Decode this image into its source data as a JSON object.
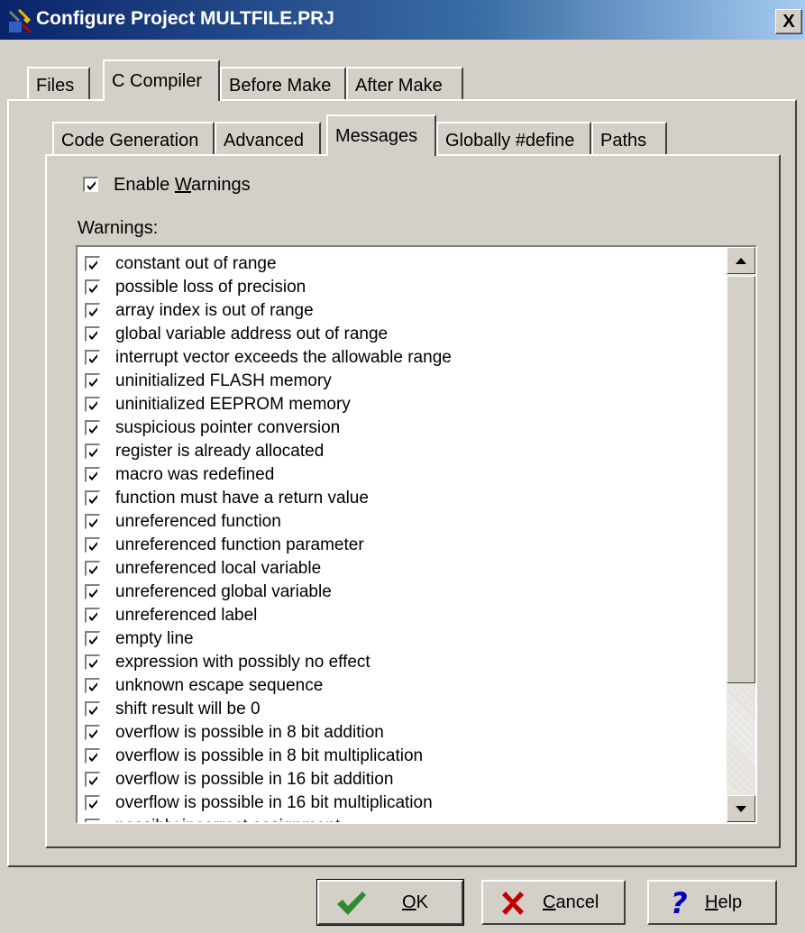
{
  "window": {
    "title": "Configure Project MULTFILE.PRJ",
    "close_label": "X"
  },
  "tabs_top": [
    {
      "label": "Files",
      "active": false
    },
    {
      "label": "C Compiler",
      "active": true
    },
    {
      "label": "Before Make",
      "active": false
    },
    {
      "label": "After Make",
      "active": false
    }
  ],
  "tabs_sub": [
    {
      "label": "Code Generation",
      "active": false
    },
    {
      "label": "Advanced",
      "active": false
    },
    {
      "label": "Messages",
      "active": true
    },
    {
      "label": "Globally #define",
      "active": false
    },
    {
      "label": "Paths",
      "active": false
    }
  ],
  "enable_warnings": {
    "checked": true,
    "label_pre": "Enable ",
    "label_accel": "W",
    "label_post": "arnings"
  },
  "warnings_label": "Warnings:",
  "warnings": [
    "constant out of range",
    "possible loss of precision",
    "array index is out of range",
    "global variable address out of range",
    "interrupt vector exceeds the allowable range",
    "uninitialized FLASH memory",
    "uninitialized EEPROM memory",
    "suspicious pointer conversion",
    "register is already allocated",
    "macro was redefined",
    "function must have a return value",
    "unreferenced function",
    "unreferenced function parameter",
    "unreferenced local variable",
    "unreferenced global variable",
    "unreferenced label",
    "empty line",
    "expression with possibly no effect",
    "unknown escape sequence",
    "shift result will be 0",
    "overflow is possible in 8 bit addition",
    "overflow is possible in 8 bit multiplication",
    "overflow is possible in 16 bit addition",
    "overflow is possible in 16 bit multiplication",
    "possibly incorrect assignment"
  ],
  "buttons": {
    "ok": {
      "accel": "O",
      "rest": "K",
      "icon": "checkmark-icon",
      "color": "#2e8b2e"
    },
    "cancel": {
      "accel": "C",
      "rest": "ancel",
      "icon": "x-icon",
      "color": "#c00000"
    },
    "help": {
      "accel": "H",
      "rest": "elp",
      "icon": "question-icon",
      "color": "#0000c0"
    }
  }
}
